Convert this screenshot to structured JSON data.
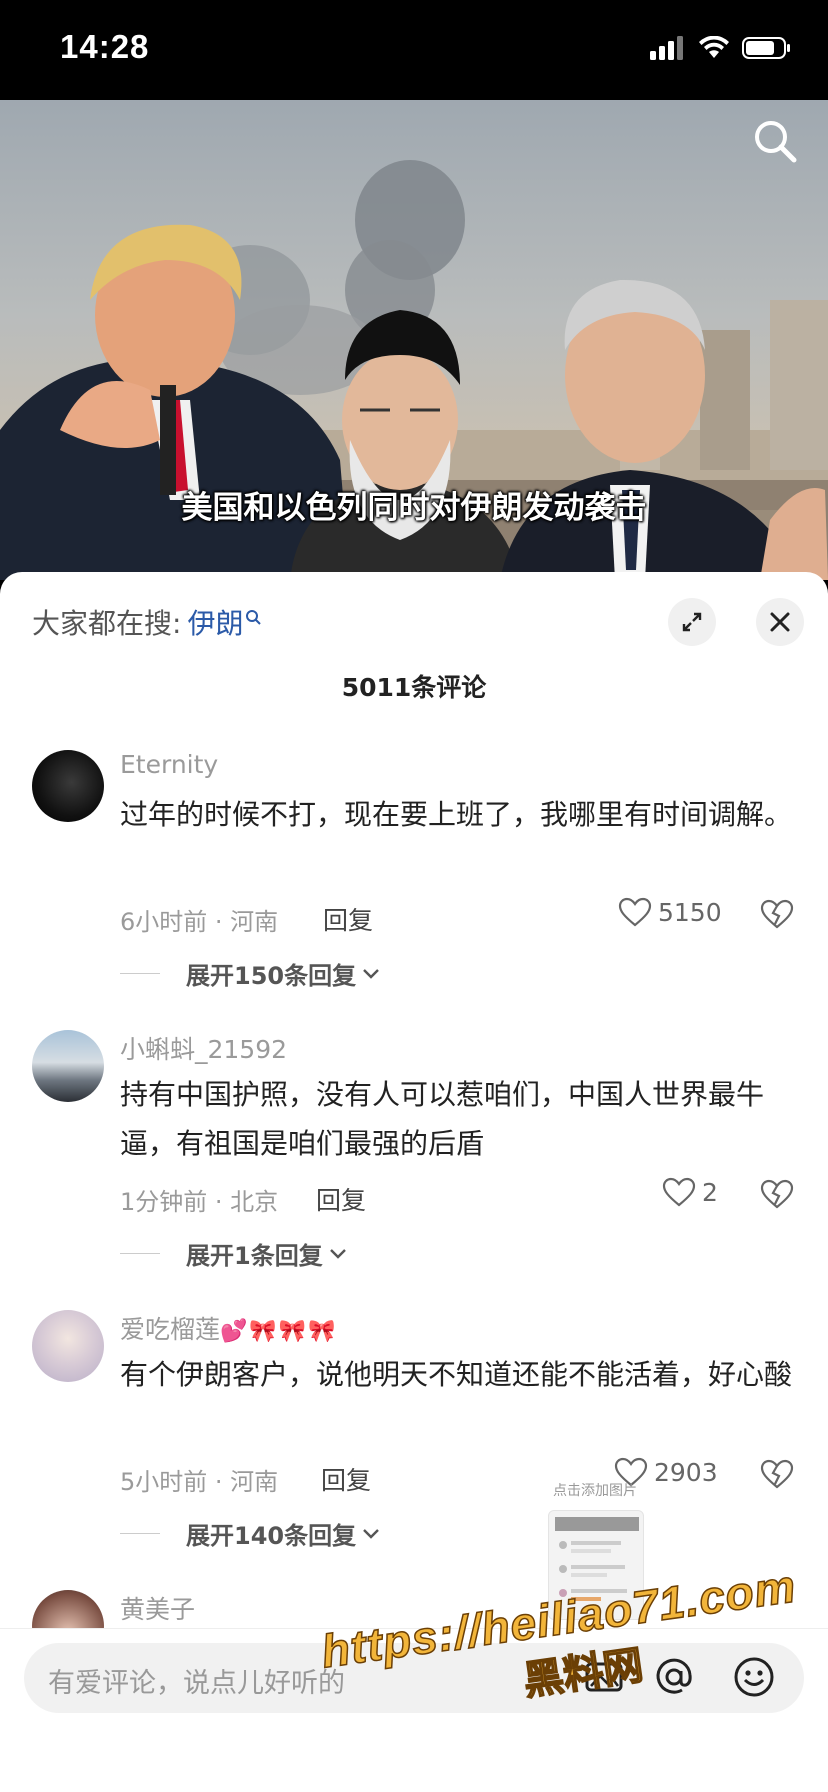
{
  "status_bar": {
    "time": "14:28"
  },
  "video": {
    "caption": "美国和以色列同时对伊朗发动袭击"
  },
  "panel": {
    "search_prefix": "大家都在搜:",
    "search_keyword": "伊朗",
    "comment_count": "5011条评论"
  },
  "comments": [
    {
      "username": "Eternity",
      "text": "过年的时候不打，现在要上班了，我哪里有时间调解。",
      "meta": "6小时前 · 河南",
      "reply": "回复",
      "likes": "5150",
      "expand": "展开150条回复"
    },
    {
      "username": "小蝌蚪_21592",
      "text": "持有中国护照，没有人可以惹咱们，中国人世界最牛逼，有祖国是咱们最强的后盾",
      "meta": "1分钟前 · 北京",
      "reply": "回复",
      "likes": "2",
      "expand": "展开1条回复"
    },
    {
      "username": "爱吃榴莲",
      "username_emoji": "💕🎀🎀🎀",
      "text": "有个伊朗客户，说他明天不知道还能不能活着，好心酸",
      "meta": "5小时前 · 河南",
      "reply": "回复",
      "likes": "2903",
      "expand": "展开140条回复"
    },
    {
      "username": "黄美子"
    }
  ],
  "add_image": {
    "label": "点击添加图片"
  },
  "input": {
    "placeholder": "有爱评论，说点儿好听的"
  },
  "watermark": {
    "url": "https://heiliao71.com",
    "name": "黑料网"
  },
  "colors": {
    "keyword": "#2b5aa8",
    "watermark": "#f2b53a"
  }
}
